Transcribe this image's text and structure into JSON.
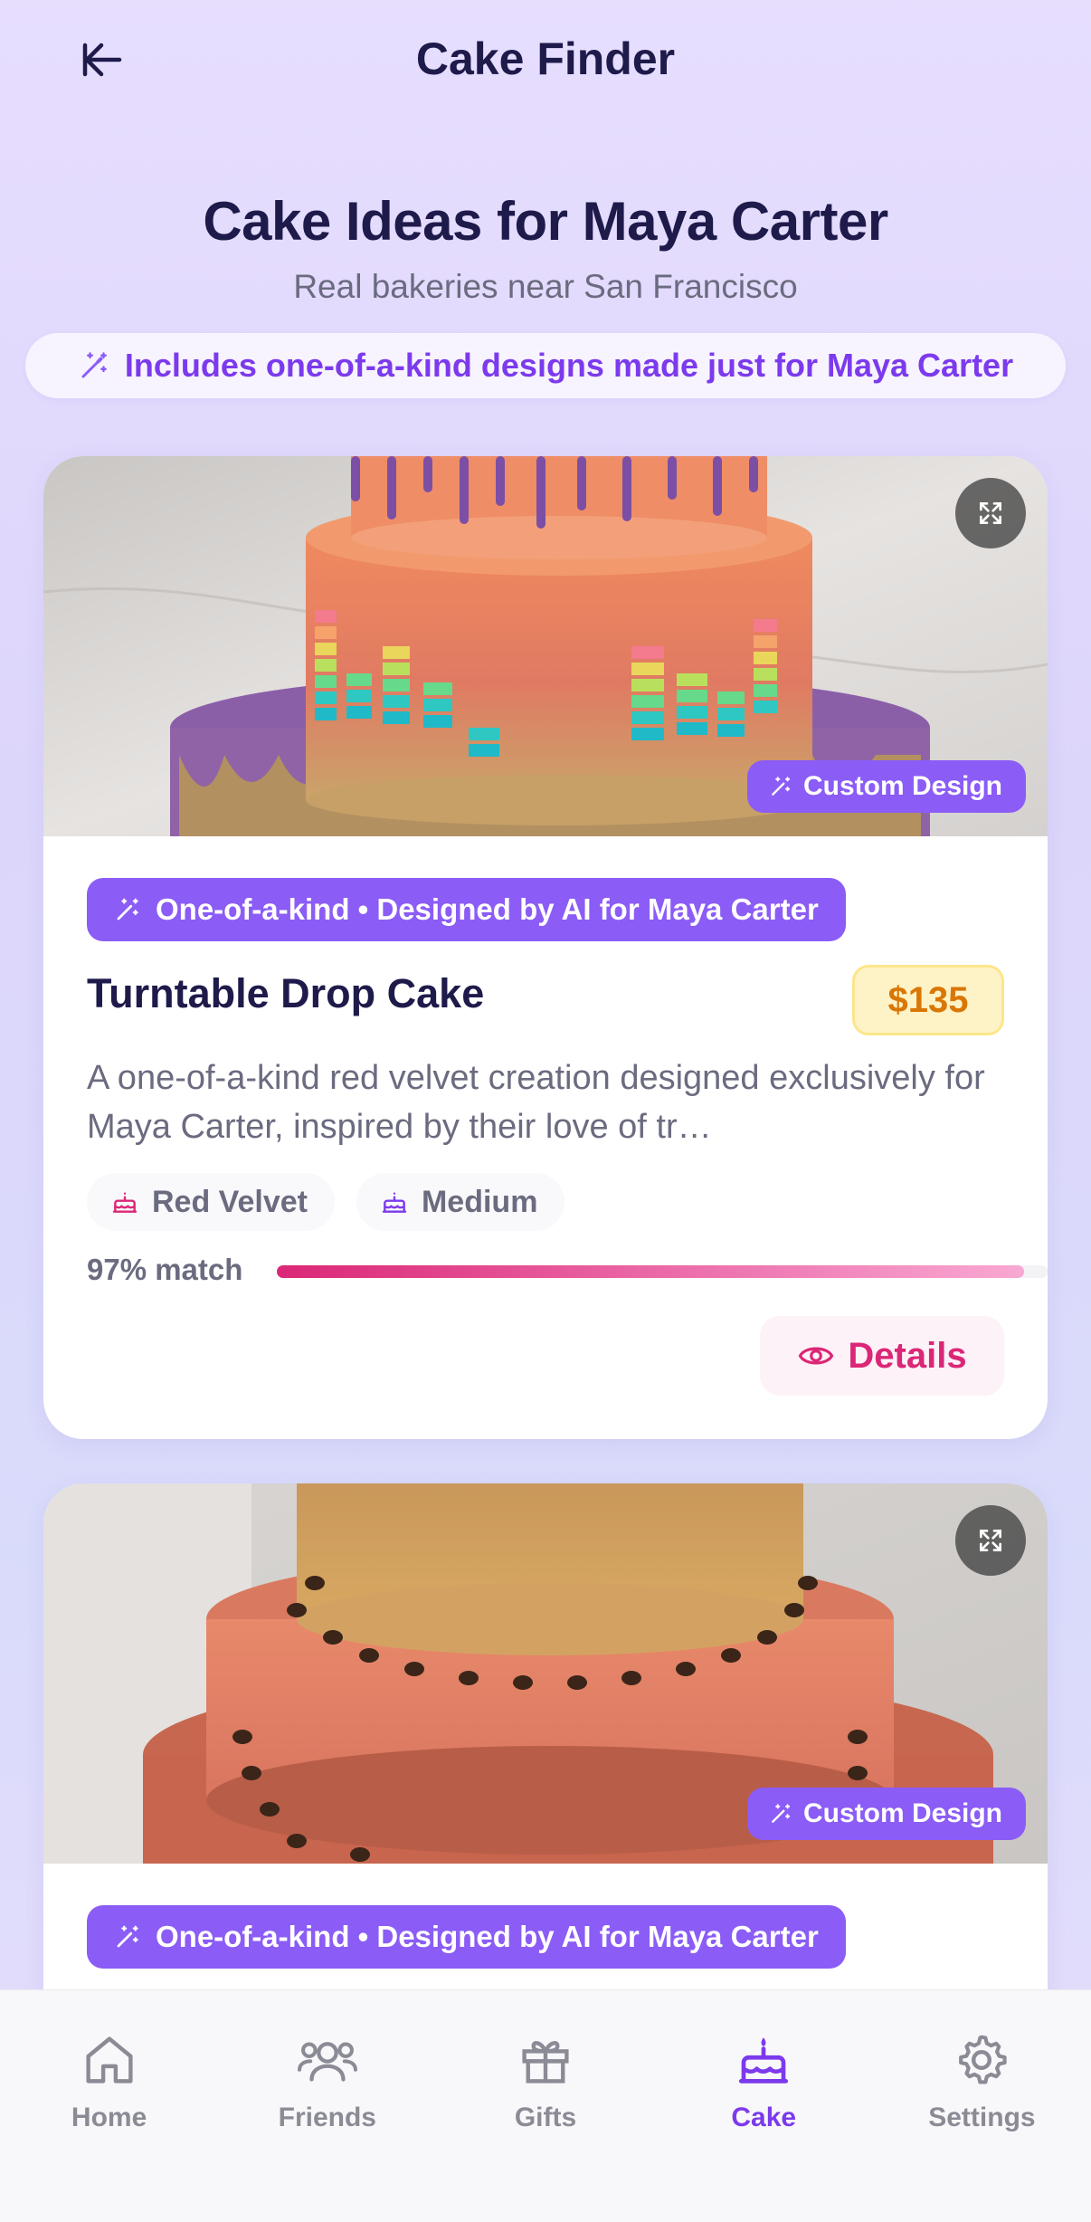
{
  "header": {
    "app_title": "Cake Finder",
    "back_icon": "back-arrow-icon"
  },
  "page": {
    "title": "Cake Ideas for Maya Carter",
    "subtitle": "Real bakeries near San Francisco",
    "banner": "Includes one-of-a-kind designs made just for Maya Carter"
  },
  "cards": [
    {
      "image_tag": "Custom Design",
      "ai_pill": "One-of-a-kind • Designed by AI for Maya Carter",
      "name": "Turntable Drop Cake",
      "price": "$135",
      "description": "A one-of-a-kind red velvet creation designed exclusively for Maya Carter, inspired by their love of tr…",
      "tags": [
        "Red Velvet",
        "Medium"
      ],
      "match_label": "97% match",
      "match_value": 0.97,
      "details_label": "Details"
    },
    {
      "image_tag": "Custom Design",
      "ai_pill": "One-of-a-kind • Designed by AI for Maya Carter"
    }
  ],
  "nav": [
    {
      "label": "Home",
      "icon": "home-icon",
      "active": false
    },
    {
      "label": "Friends",
      "icon": "friends-icon",
      "active": false
    },
    {
      "label": "Gifts",
      "icon": "gift-icon",
      "active": false
    },
    {
      "label": "Cake",
      "icon": "cake-icon",
      "active": true
    },
    {
      "label": "Settings",
      "icon": "settings-icon",
      "active": false
    }
  ],
  "colors": {
    "accent_purple": "#8b5cf6",
    "pink": "#db2777",
    "price_text": "#d97706",
    "title": "#1e1b4b"
  }
}
